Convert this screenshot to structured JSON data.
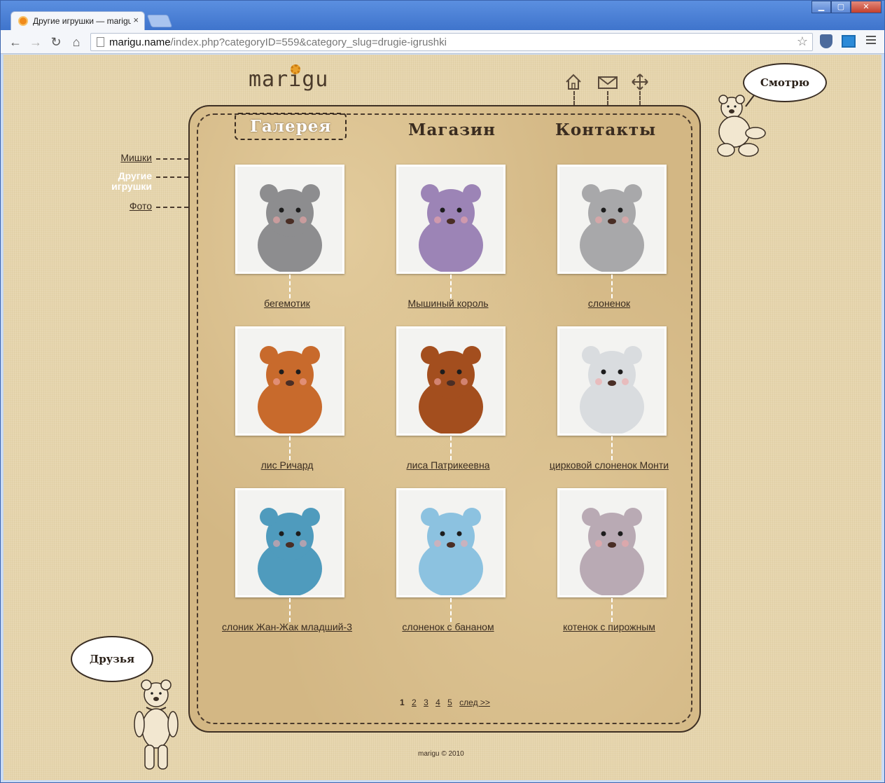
{
  "browser": {
    "tab_title": "Другие игрушки — marigu",
    "tab_close": "×",
    "url_host": "marigu.name",
    "url_path": "/index.php?categoryID=559&category_slug=drugie-igrushki",
    "back": "←",
    "forward": "→",
    "reload": "↻",
    "home": "⌂",
    "star": "☆",
    "win_min": "▁",
    "win_max": "▢",
    "win_close": "✕"
  },
  "header": {
    "logo": "marigu",
    "icons": [
      "home-icon",
      "mail-icon",
      "move-icon"
    ],
    "bubble_top": "Смотрю",
    "bubble_bottom": "Друзья"
  },
  "nav": {
    "gallery": "Галерея",
    "shop": "Магазин",
    "contacts": "Контакты"
  },
  "sidebar": {
    "items": [
      {
        "label": "Мишки"
      },
      {
        "label": "Другие игрушки"
      },
      {
        "label": "Фото"
      }
    ]
  },
  "gallery": {
    "items": [
      {
        "title": "бегемотик",
        "color": "#8d8d8f"
      },
      {
        "title": "Мышиный король",
        "color": "#9c84b6"
      },
      {
        "title": "слоненок",
        "color": "#a8a8aa"
      },
      {
        "title": "лис Ричард",
        "color": "#c86a2c"
      },
      {
        "title": "лиса Патрикеевна",
        "color": "#a34e1e"
      },
      {
        "title": "цирковой слоненок Монти",
        "color": "#d9dcdf"
      },
      {
        "title": "слоник Жан-Жак младший-3",
        "color": "#4f9bbd"
      },
      {
        "title": "слоненок с бананом",
        "color": "#8cc2e0"
      },
      {
        "title": "котенок с пирожным",
        "color": "#b9aab4"
      }
    ]
  },
  "pager": {
    "current": "1",
    "pages": [
      "2",
      "3",
      "4",
      "5"
    ],
    "next": "след >>"
  },
  "footer": "marigu © 2010"
}
